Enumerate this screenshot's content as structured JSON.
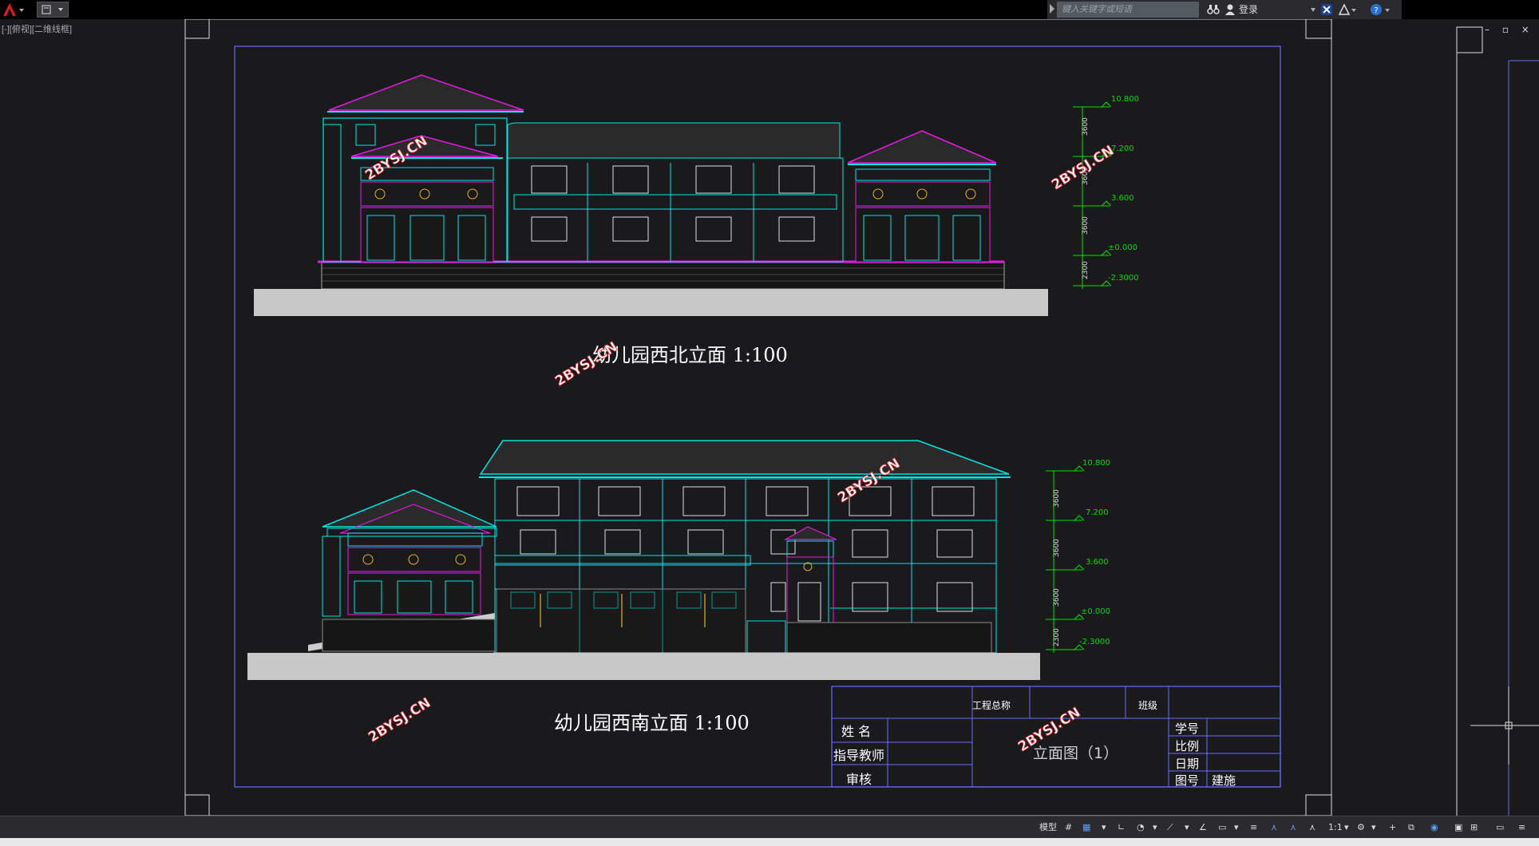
{
  "toolbar": {
    "app_icon": "autocad-logo-icon",
    "search_placeholder": "键入关键字或短语",
    "login_label": "登录"
  },
  "viewport": {
    "view_label": "[-][俯视][二维线框]"
  },
  "drawing": {
    "northwest_title": "幼儿园西北立面 1:100",
    "southwest_title": "幼儿园西南立面 1:100",
    "watermark": "2BYSJ.CN",
    "elevations_top": [
      "10.800",
      "7.200",
      "3.600",
      "±0.000",
      "-2.3000"
    ],
    "dims_top": [
      "3600",
      "3600",
      "3600",
      "2300"
    ],
    "elevations_bottom": [
      "10.800",
      "7.200",
      "3.600",
      "±0.000",
      "-2.3000"
    ],
    "dims_bottom": [
      "3600",
      "3600",
      "3600",
      "2300"
    ]
  },
  "title_block": {
    "project_name_label": "工程总称",
    "class_label": "班级",
    "name_label": "姓 名",
    "advisor_label": "指导教师",
    "review_label": "审核",
    "drawing_title": "立面图（1）",
    "student_id_label": "学号",
    "scale_label": "比例",
    "date_label": "日期",
    "drawing_no_label": "图号",
    "drawing_no_value": "建施"
  },
  "statusbar": {
    "model_label": "模型",
    "scale_value": "1:1"
  },
  "colors": {
    "cyan": "#00e5e5",
    "magenta": "#e51ae5",
    "green": "#00e000",
    "watermark": "#e0303a",
    "frame": "#6a6aff"
  }
}
